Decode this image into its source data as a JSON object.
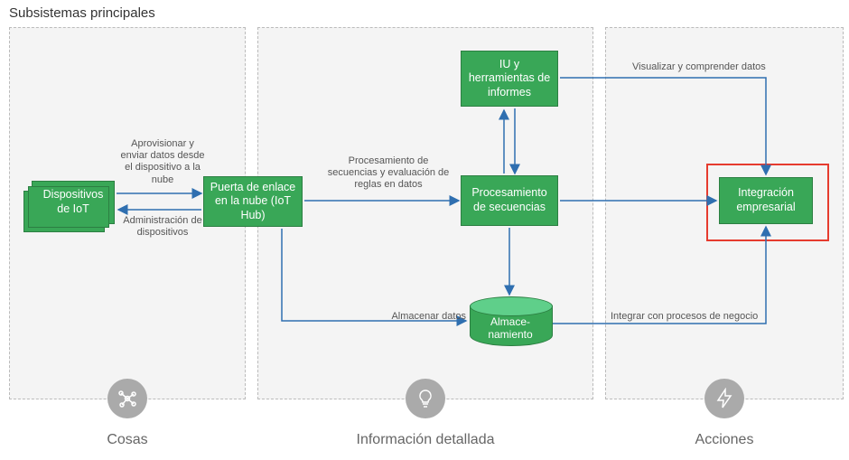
{
  "title": "Subsistemas principales",
  "zones": {
    "things": {
      "label": "Cosas"
    },
    "insight": {
      "label": "Información detallada"
    },
    "actions": {
      "label": "Acciones"
    }
  },
  "nodes": {
    "devices": {
      "label": "Dispositivos de IoT"
    },
    "gateway": {
      "label": "Puerta de enlace en la nube (IoT Hub)"
    },
    "ui": {
      "label": "IU y herramientas de informes"
    },
    "stream": {
      "label": "Procesamiento de secuencias"
    },
    "storage": {
      "label": "Almace-\nnamiento"
    },
    "biz": {
      "label": "Integración empresarial"
    }
  },
  "edges": {
    "provision": "Aprovisionar y enviar datos desde el dispositivo a la nube",
    "manage": "Administración de dispositivos",
    "rules": "Procesamiento de secuencias y evaluación de reglas en datos",
    "store": "Almacenar datos",
    "integrate": "Integrar con procesos de negocio",
    "visualize": "Visualizar y comprender datos"
  },
  "highlighted_node": "biz"
}
